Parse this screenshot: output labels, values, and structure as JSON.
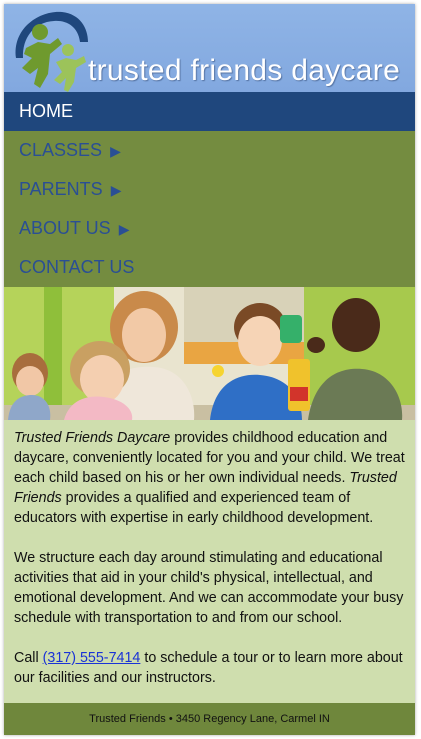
{
  "header": {
    "site_title": "trusted friends daycare",
    "logo_icon": "family-figures-logo"
  },
  "nav": {
    "items": [
      {
        "label": "HOME",
        "active": true,
        "has_submenu": false
      },
      {
        "label": "CLASSES",
        "active": false,
        "has_submenu": true
      },
      {
        "label": "PARENTS",
        "active": false,
        "has_submenu": true
      },
      {
        "label": "ABOUT US",
        "active": false,
        "has_submenu": true
      },
      {
        "label": "CONTACT US",
        "active": false,
        "has_submenu": false
      }
    ],
    "submenu_arrow": "▶"
  },
  "content": {
    "p1": {
      "em1": "Trusted Friends Daycare",
      "text1": " provides childhood education and daycare, conveniently located for you and your child. We treat each child based on his or her own individual needs. ",
      "em2": "Trusted Friends",
      "text2": " provides a qualified and experienced team of educators with expertise in early childhood development."
    },
    "p2": "We structure each day around stimulating and educational activities that aid in your child's physical, intellectual, and emotional development. And we can accommodate your busy schedule with transportation to and from our school.",
    "p3": {
      "before": "Call ",
      "phone": "(317) 555-7414",
      "after": " to schedule a tour or to learn more about our facilities and our instructors."
    }
  },
  "footer": {
    "text": "Trusted Friends • 3450 Regency Lane, Carmel IN"
  },
  "colors": {
    "header_blue": "#8fb4e6",
    "nav_active": "#1f477d",
    "nav_green": "#748c40",
    "content_bg": "#cfdeae",
    "footer_green": "#6f873c"
  }
}
